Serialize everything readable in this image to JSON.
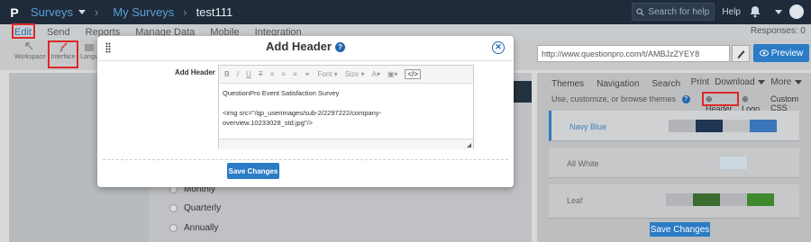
{
  "topbar": {
    "logo": "P",
    "breadcrumb": [
      "Surveys",
      "My Surveys",
      "test111"
    ],
    "search_placeholder": "Search for help",
    "help_label": "Help"
  },
  "menu": {
    "items": [
      "Edit",
      "Send",
      "Reports",
      "Manage Data",
      "Mobile",
      "Integration"
    ],
    "responses": "Responses: 0"
  },
  "toolbar": {
    "tools": [
      "Workspace",
      "Interface",
      "Langu"
    ],
    "url": "http://www.questionpro.com/t/AMBJzZYEY8",
    "preview_label": "Preview"
  },
  "survey": {
    "options": [
      "Monthly",
      "Quarterly",
      "Annually"
    ]
  },
  "right_panel": {
    "tabs": [
      "Themes",
      "Navigation",
      "Search"
    ],
    "actions": [
      "Print",
      "Download",
      "More"
    ],
    "subtitle": "Use, customize, or browse themes",
    "links": [
      "Header",
      "Logo",
      "Custom CSS"
    ],
    "themes": [
      {
        "name": "Navy Blue",
        "active": true,
        "colors": [
          "#b2b4b7",
          "#1f3652",
          "#bdbfc1",
          "#3a75b9"
        ]
      },
      {
        "name": "All White",
        "active": false,
        "colors": [
          "#c6c8ca",
          "#c6c8ca",
          "#cbd8e0",
          "#c6c8ca"
        ]
      },
      {
        "name": "Leaf",
        "active": false,
        "colors": [
          "#b2b4b7",
          "#3b6b2e",
          "#b2b4b7",
          "#3f8a2d"
        ]
      }
    ],
    "save_label": "Save Changes"
  },
  "modal": {
    "title": "Add Header",
    "field_label": "Add Header",
    "toolbar": {
      "bold": "B",
      "italic": "I",
      "underline": "U",
      "strike": "T",
      "font": "Font",
      "size": "Size",
      "color": "A",
      "source": "</>"
    },
    "content_line1": "QuestionPro Event Satisfaction Survey",
    "content_line2": "<img src=\"/qp_userimages/sub-2/2297222/company-overview.10233028_std.jpg\"/>",
    "save_label": "Save Changes"
  },
  "colors": {
    "accent": "#2b7bc5",
    "highlight": "#e0262b",
    "topbar": "#1f2b3a"
  }
}
